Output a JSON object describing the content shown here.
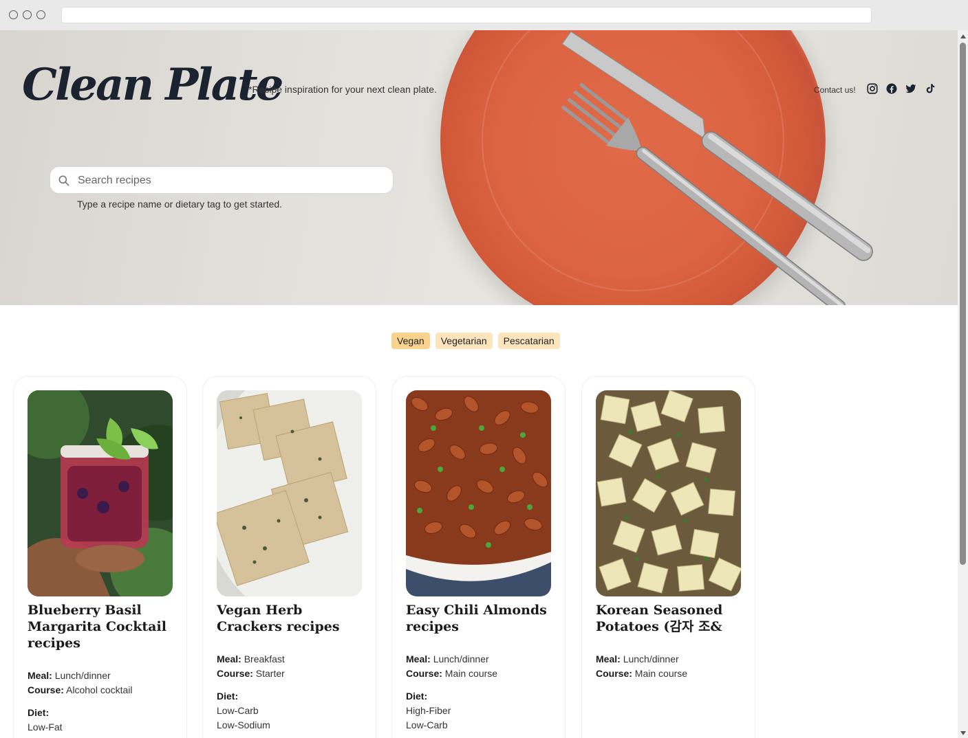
{
  "site": {
    "logo": "Clean Plate",
    "tagline": "*Recipe inspiration for your next clean plate.",
    "contact": "Contact us!",
    "social": [
      "instagram-icon",
      "facebook-icon",
      "twitter-icon",
      "tiktok-icon"
    ]
  },
  "search": {
    "placeholder": "Search recipes",
    "hint": "Type a recipe name or dietary tag to get started."
  },
  "filters": [
    "Vegan",
    "Vegetarian",
    "Pescatarian"
  ],
  "labels": {
    "meal": "Meal:",
    "course": "Course:",
    "diet": "Diet:"
  },
  "recipes": [
    {
      "title": "Blueberry Basil Margarita Cocktail recipes",
      "meal": "Lunch/dinner",
      "course": "Alcohol cocktail",
      "diet": [
        "Low-Fat"
      ]
    },
    {
      "title": "Vegan Herb Crackers recipes",
      "meal": "Breakfast",
      "course": "Starter",
      "diet": [
        "Low-Carb",
        "Low-Sodium"
      ]
    },
    {
      "title": "Easy Chili Almonds recipes",
      "meal": "Lunch/dinner",
      "course": "Main course",
      "diet": [
        "High-Fiber",
        "Low-Carb"
      ]
    },
    {
      "title": "Korean Seasoned Potatoes (감자 조&",
      "meal": "Lunch/dinner",
      "course": "Main course",
      "diet": []
    }
  ],
  "colors": {
    "chip": "#fce5bd",
    "chip_active": "#f9d38e",
    "plate": "#dc6442",
    "logo": "#1c2330"
  }
}
